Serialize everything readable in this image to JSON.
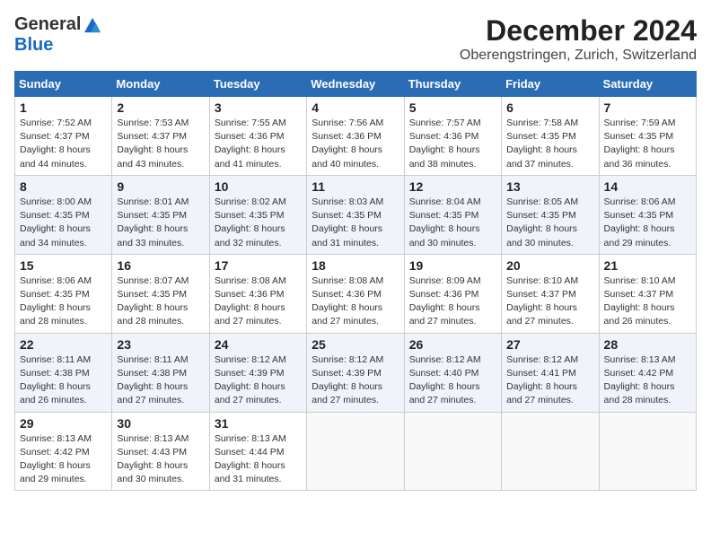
{
  "header": {
    "logo_general": "General",
    "logo_blue": "Blue",
    "month_title": "December 2024",
    "location": "Oberengstringen, Zurich, Switzerland"
  },
  "days_of_week": [
    "Sunday",
    "Monday",
    "Tuesday",
    "Wednesday",
    "Thursday",
    "Friday",
    "Saturday"
  ],
  "weeks": [
    [
      {
        "day": "1",
        "sunrise": "7:52 AM",
        "sunset": "4:37 PM",
        "daylight": "8 hours and 44 minutes."
      },
      {
        "day": "2",
        "sunrise": "7:53 AM",
        "sunset": "4:37 PM",
        "daylight": "8 hours and 43 minutes."
      },
      {
        "day": "3",
        "sunrise": "7:55 AM",
        "sunset": "4:36 PM",
        "daylight": "8 hours and 41 minutes."
      },
      {
        "day": "4",
        "sunrise": "7:56 AM",
        "sunset": "4:36 PM",
        "daylight": "8 hours and 40 minutes."
      },
      {
        "day": "5",
        "sunrise": "7:57 AM",
        "sunset": "4:36 PM",
        "daylight": "8 hours and 38 minutes."
      },
      {
        "day": "6",
        "sunrise": "7:58 AM",
        "sunset": "4:35 PM",
        "daylight": "8 hours and 37 minutes."
      },
      {
        "day": "7",
        "sunrise": "7:59 AM",
        "sunset": "4:35 PM",
        "daylight": "8 hours and 36 minutes."
      }
    ],
    [
      {
        "day": "8",
        "sunrise": "8:00 AM",
        "sunset": "4:35 PM",
        "daylight": "8 hours and 34 minutes."
      },
      {
        "day": "9",
        "sunrise": "8:01 AM",
        "sunset": "4:35 PM",
        "daylight": "8 hours and 33 minutes."
      },
      {
        "day": "10",
        "sunrise": "8:02 AM",
        "sunset": "4:35 PM",
        "daylight": "8 hours and 32 minutes."
      },
      {
        "day": "11",
        "sunrise": "8:03 AM",
        "sunset": "4:35 PM",
        "daylight": "8 hours and 31 minutes."
      },
      {
        "day": "12",
        "sunrise": "8:04 AM",
        "sunset": "4:35 PM",
        "daylight": "8 hours and 30 minutes."
      },
      {
        "day": "13",
        "sunrise": "8:05 AM",
        "sunset": "4:35 PM",
        "daylight": "8 hours and 30 minutes."
      },
      {
        "day": "14",
        "sunrise": "8:06 AM",
        "sunset": "4:35 PM",
        "daylight": "8 hours and 29 minutes."
      }
    ],
    [
      {
        "day": "15",
        "sunrise": "8:06 AM",
        "sunset": "4:35 PM",
        "daylight": "8 hours and 28 minutes."
      },
      {
        "day": "16",
        "sunrise": "8:07 AM",
        "sunset": "4:35 PM",
        "daylight": "8 hours and 28 minutes."
      },
      {
        "day": "17",
        "sunrise": "8:08 AM",
        "sunset": "4:36 PM",
        "daylight": "8 hours and 27 minutes."
      },
      {
        "day": "18",
        "sunrise": "8:08 AM",
        "sunset": "4:36 PM",
        "daylight": "8 hours and 27 minutes."
      },
      {
        "day": "19",
        "sunrise": "8:09 AM",
        "sunset": "4:36 PM",
        "daylight": "8 hours and 27 minutes."
      },
      {
        "day": "20",
        "sunrise": "8:10 AM",
        "sunset": "4:37 PM",
        "daylight": "8 hours and 27 minutes."
      },
      {
        "day": "21",
        "sunrise": "8:10 AM",
        "sunset": "4:37 PM",
        "daylight": "8 hours and 26 minutes."
      }
    ],
    [
      {
        "day": "22",
        "sunrise": "8:11 AM",
        "sunset": "4:38 PM",
        "daylight": "8 hours and 26 minutes."
      },
      {
        "day": "23",
        "sunrise": "8:11 AM",
        "sunset": "4:38 PM",
        "daylight": "8 hours and 27 minutes."
      },
      {
        "day": "24",
        "sunrise": "8:12 AM",
        "sunset": "4:39 PM",
        "daylight": "8 hours and 27 minutes."
      },
      {
        "day": "25",
        "sunrise": "8:12 AM",
        "sunset": "4:39 PM",
        "daylight": "8 hours and 27 minutes."
      },
      {
        "day": "26",
        "sunrise": "8:12 AM",
        "sunset": "4:40 PM",
        "daylight": "8 hours and 27 minutes."
      },
      {
        "day": "27",
        "sunrise": "8:12 AM",
        "sunset": "4:41 PM",
        "daylight": "8 hours and 27 minutes."
      },
      {
        "day": "28",
        "sunrise": "8:13 AM",
        "sunset": "4:42 PM",
        "daylight": "8 hours and 28 minutes."
      }
    ],
    [
      {
        "day": "29",
        "sunrise": "8:13 AM",
        "sunset": "4:42 PM",
        "daylight": "8 hours and 29 minutes."
      },
      {
        "day": "30",
        "sunrise": "8:13 AM",
        "sunset": "4:43 PM",
        "daylight": "8 hours and 30 minutes."
      },
      {
        "day": "31",
        "sunrise": "8:13 AM",
        "sunset": "4:44 PM",
        "daylight": "8 hours and 31 minutes."
      },
      null,
      null,
      null,
      null
    ]
  ],
  "labels": {
    "sunrise": "Sunrise:",
    "sunset": "Sunset:",
    "daylight": "Daylight:"
  }
}
